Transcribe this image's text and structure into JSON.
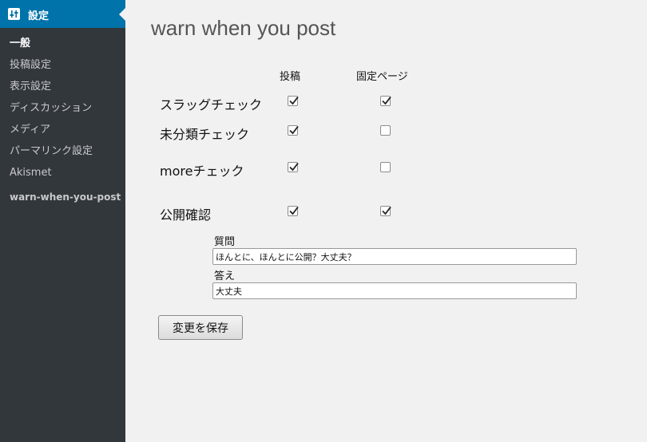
{
  "sidebar": {
    "menu_label": "設定",
    "menu_icon": "settings-sliders-icon",
    "items": [
      {
        "label": "一般",
        "current": true
      },
      {
        "label": "投稿設定",
        "current": false
      },
      {
        "label": "表示設定",
        "current": false
      },
      {
        "label": "ディスカッション",
        "current": false
      },
      {
        "label": "メディア",
        "current": false
      },
      {
        "label": "パーマリンク設定",
        "current": false
      },
      {
        "label": "Akismet",
        "current": false
      }
    ],
    "plugin_label": "warn-when-you-post"
  },
  "main": {
    "title": "warn when you post",
    "columns": [
      "投稿",
      "固定ページ"
    ],
    "rows": [
      {
        "label": "スラッグチェック",
        "post": true,
        "page": true
      },
      {
        "label": "未分類チェック",
        "post": true,
        "page": false
      },
      {
        "label": "moreチェック",
        "post": true,
        "page": false
      },
      {
        "label": "公開確認",
        "post": true,
        "page": true
      }
    ],
    "question_label": "質問",
    "question_value": "ほんとに、ほんとに公開？大丈夫？",
    "answer_label": "答え",
    "answer_value": "大丈夫",
    "save_label": "変更を保存"
  },
  "colors": {
    "sidebar_bg": "#32373c",
    "active_menu_bg": "#0073aa",
    "content_bg": "#f1f1f1"
  }
}
